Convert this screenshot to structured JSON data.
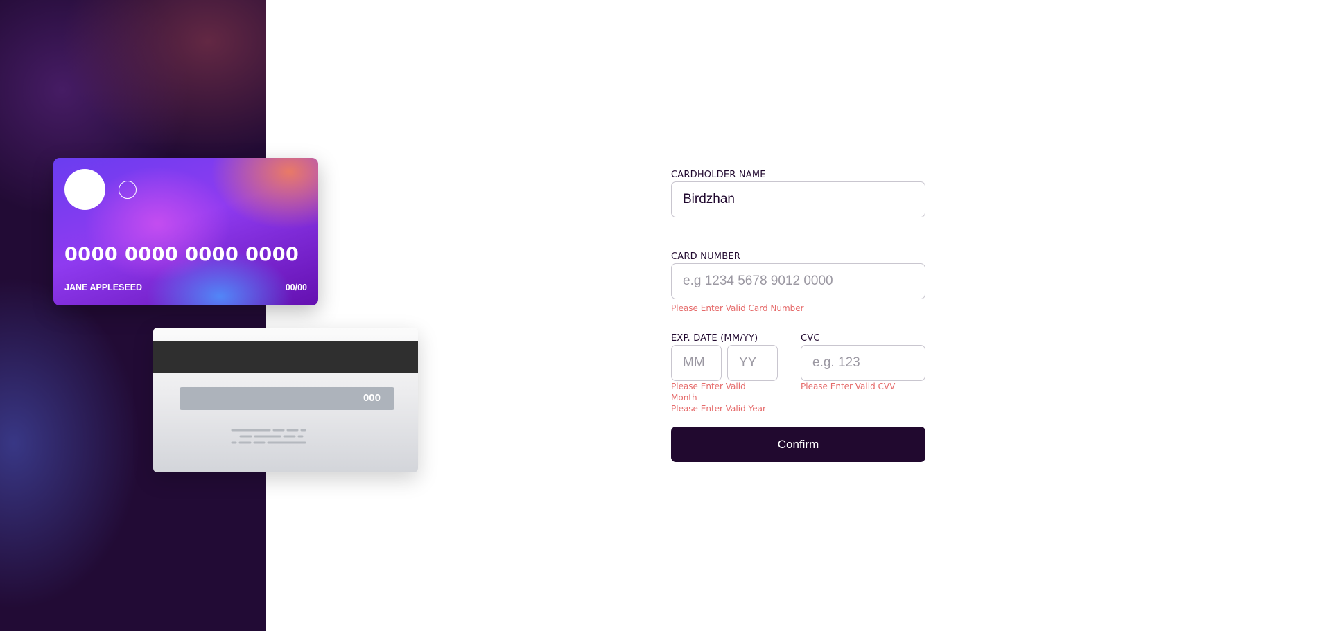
{
  "card_front": {
    "number": "0000 0000 0000 0000",
    "holder": "JANE APPLESEED",
    "expiry": "00/00"
  },
  "card_back": {
    "cvc": "000"
  },
  "form": {
    "name": {
      "label": "CARDHOLDER NAME",
      "value": "Birdzhan"
    },
    "number": {
      "label": "CARD NUMBER",
      "placeholder": "e.g 1234 5678 9012 0000",
      "error": "Please Enter Valid Card Number"
    },
    "exp": {
      "label": "EXP. DATE (MM/YY)",
      "month_placeholder": "MM",
      "year_placeholder": "YY",
      "month_error": "Please Enter Valid Month",
      "year_error": "Please Enter Valid Year"
    },
    "cvc": {
      "label": "CVC",
      "placeholder": "e.g. 123",
      "error": "Please Enter Valid CVV"
    },
    "confirm_label": "Confirm"
  },
  "colors": {
    "dark_violet": "#21092f",
    "error_red": "#e56a6a",
    "input_border": "#c9c6cf"
  }
}
